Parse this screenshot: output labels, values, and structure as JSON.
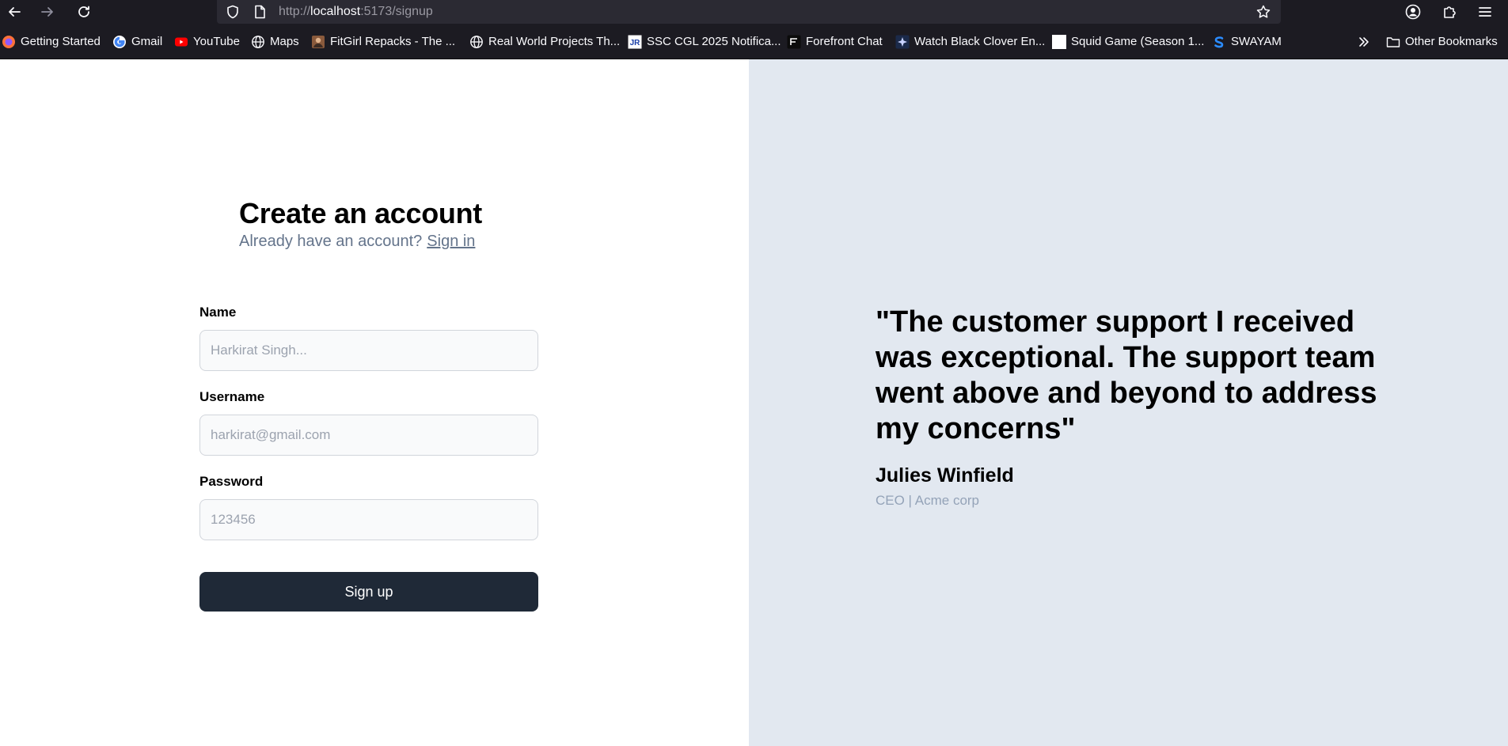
{
  "browser": {
    "url_prefix": "http://",
    "url_host": "localhost",
    "url_rest": ":5173/signup",
    "bookmarks": [
      {
        "label": "Getting Started",
        "icon": "firefox-icon"
      },
      {
        "label": "Gmail",
        "icon": "google-icon"
      },
      {
        "label": "YouTube",
        "icon": "youtube-icon"
      },
      {
        "label": "Maps",
        "icon": "globe-icon"
      },
      {
        "label": "FitGirl Repacks - The ...",
        "icon": "fitgirl-icon"
      },
      {
        "label": "Real World Projects Th...",
        "icon": "globe-icon"
      },
      {
        "label": "SSC CGL 2025 Notifica...",
        "icon": "jr-icon"
      },
      {
        "label": "Forefront Chat",
        "icon": "forefront-icon"
      },
      {
        "label": "Watch Black Clover En...",
        "icon": "blackclover-icon"
      },
      {
        "label": "Squid Game (Season 1...",
        "icon": "blank-page-icon"
      },
      {
        "label": "SWAYAM",
        "icon": "swayam-icon"
      }
    ],
    "other_bookmarks": "Other Bookmarks"
  },
  "signup": {
    "title": "Create an account",
    "subtitle": "Already have an account?",
    "signin_link": "Sign in",
    "fields": [
      {
        "label": "Name",
        "placeholder": "Harkirat Singh...",
        "value": ""
      },
      {
        "label": "Username",
        "placeholder": "harkirat@gmail.com",
        "value": ""
      },
      {
        "label": "Password",
        "placeholder": "123456",
        "value": ""
      }
    ],
    "submit_label": "Sign up"
  },
  "testimonial": {
    "quote": "\"The customer support I received was exceptional. The support team went above and beyond to address my concerns\"",
    "author": "Julies Winfield",
    "role": "CEO | Acme corp"
  },
  "colors": {
    "chrome_bg": "#1c1b22",
    "urlbar_bg": "#2b2a33",
    "quote_panel_bg": "#e2e8f0",
    "button_bg": "#1f2937",
    "muted_text": "#64748b"
  }
}
